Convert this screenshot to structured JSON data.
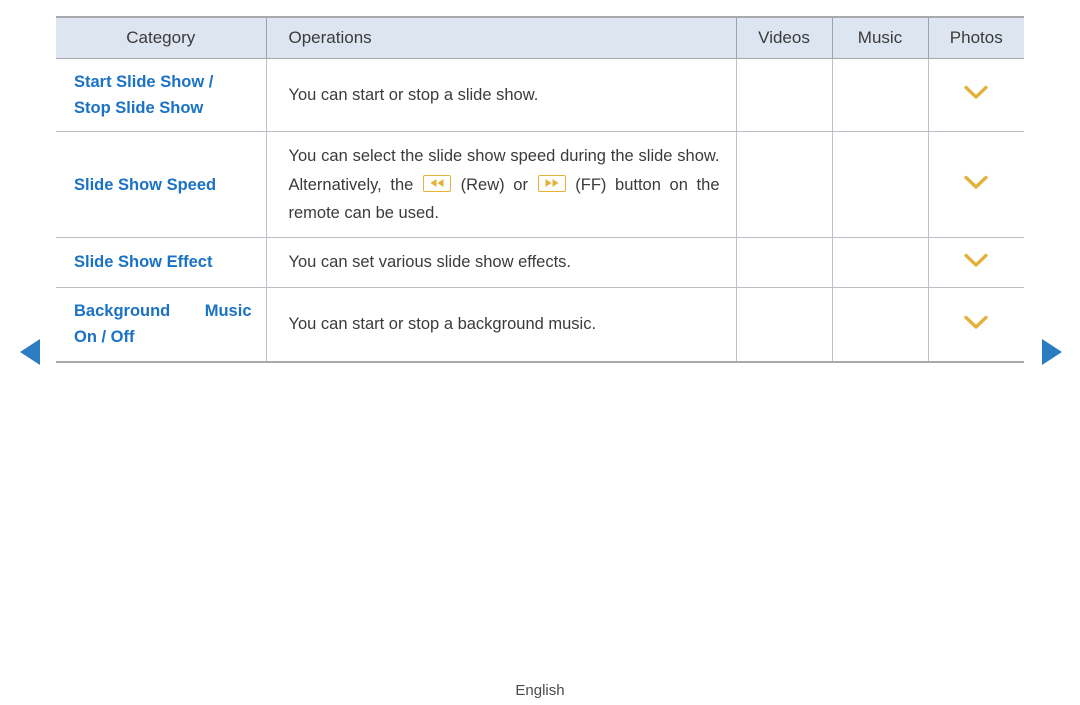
{
  "table": {
    "columns": [
      {
        "id": "category",
        "label": "Category"
      },
      {
        "id": "operations",
        "label": "Operations"
      },
      {
        "id": "videos",
        "label": "Videos"
      },
      {
        "id": "music",
        "label": "Music"
      },
      {
        "id": "photos",
        "label": "Photos"
      }
    ],
    "rows": [
      {
        "category_line1": "Start Slide Show /",
        "category_line2": "Stop Slide Show",
        "operations_text": "You can start or stop a slide show.",
        "videos": "",
        "music": "",
        "photos": "check-mark"
      },
      {
        "category_line1": "Slide Show Speed",
        "category_line2": "",
        "operations_text": "You can select the slide show speed during the slide show. Alternatively, the  (Rew) or  (FF) button on the remote can be used.",
        "operations_part1": "You can select the slide show speed during the slide show. Alternatively, the ",
        "operations_part2": " (Rew) or ",
        "operations_part3": " (FF) button on the remote can be used.",
        "icon1": "rewind-icon",
        "icon2": "fast-forward-icon",
        "videos": "",
        "music": "",
        "photos": "check-mark"
      },
      {
        "category_line1": "Slide Show Effect",
        "category_line2": "",
        "operations_text": "You can set various slide show effects.",
        "videos": "",
        "music": "",
        "photos": "check-mark"
      },
      {
        "category_line1": "Background Music",
        "category_line2": "On / Off",
        "operations_text": "You can start or stop a background music.",
        "videos": "",
        "music": "",
        "photos": "check-mark"
      }
    ]
  },
  "navigation": {
    "prev_label": "previous-page-arrow",
    "next_label": "next-page-arrow"
  },
  "footer": {
    "language": "English"
  },
  "colors": {
    "category_text": "#1a72c4",
    "header_bg": "#dce5f0",
    "accent_gold": "#e2b23c",
    "nav_blue": "#2b7cc0",
    "body_text": "#3b3b3b"
  }
}
